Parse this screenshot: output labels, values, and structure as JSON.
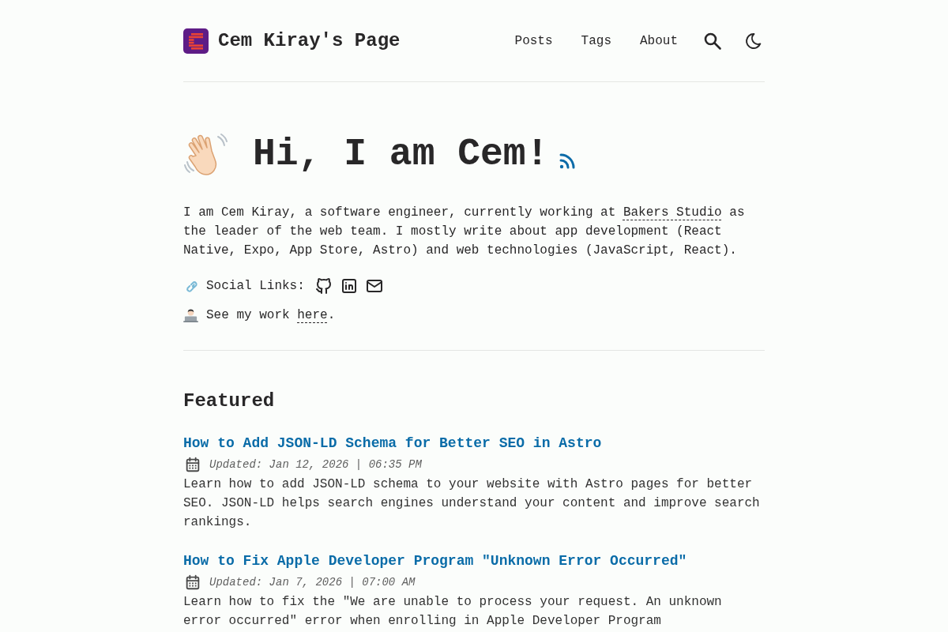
{
  "header": {
    "site_title": "Cem Kiray's Page",
    "nav": [
      {
        "label": "Posts"
      },
      {
        "label": "Tags"
      },
      {
        "label": "About"
      }
    ]
  },
  "hero": {
    "title": "Hi, I am Cem!",
    "intro": [
      {
        "kind": "text",
        "text": "I am Cem Kiray, a software engineer, currently working at "
      },
      {
        "kind": "link",
        "text": "Bakers Studio"
      },
      {
        "kind": "text",
        "text": " as the leader of the web team. I mostly write about app development (React Native, Expo, App Store, Astro) and web technologies (JavaScript, React)."
      }
    ],
    "social_links": {
      "label": "Social Links:"
    },
    "work_note": [
      {
        "kind": "text",
        "text": "See my work "
      },
      {
        "kind": "link",
        "text": "here"
      },
      {
        "kind": "text",
        "text": "."
      }
    ]
  },
  "featured": {
    "heading": "Featured",
    "posts": [
      {
        "title": "How to Add JSON-LD Schema for Better SEO in Astro",
        "date": "Updated: Jan 12, 2026 | 06:35 PM",
        "description": "Learn how to add JSON-LD schema to your website with Astro pages for better SEO. JSON-LD helps search engines understand your content and improve search rankings."
      },
      {
        "title": "How to Fix Apple Developer Program \"Unknown Error Occurred\"",
        "date": "Updated: Jan 7, 2026 | 07:00 AM",
        "description": "Learn how to fix the \"We are unable to process your request. An unknown error occurred\" error when enrolling in Apple Developer Program"
      }
    ]
  }
}
